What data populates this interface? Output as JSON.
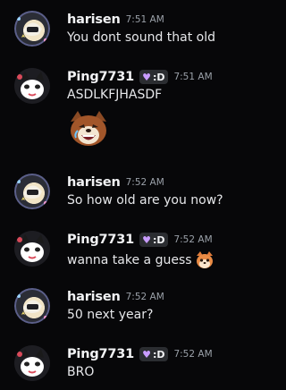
{
  "messages": [
    {
      "author": "harisen",
      "time": "7:51 AM",
      "text": "You dont sound that old"
    },
    {
      "author": "Ping7731",
      "tag": ":D",
      "time": "7:51 AM",
      "text": "ASDLKFJHASDF",
      "sticker": "wolf-laughing-emoji"
    },
    {
      "author": "harisen",
      "time": "7:52 AM",
      "text": "So how old are you now?"
    },
    {
      "author": "Ping7731",
      "tag": ":D",
      "time": "7:52 AM",
      "text": "wanna take a guess",
      "inline_emoji": "fox-face-emoji"
    },
    {
      "author": "harisen",
      "time": "7:52 AM",
      "text": "50 next year?"
    },
    {
      "author": "Ping7731",
      "tag": ":D",
      "time": "7:52 AM",
      "text": "BRO"
    }
  ],
  "icons": {
    "tag_icon": "purple-heart-icon"
  },
  "colors": {
    "background": "#070709",
    "tag_heart": "#c99cff",
    "timestamp": "#9aa0a8"
  }
}
